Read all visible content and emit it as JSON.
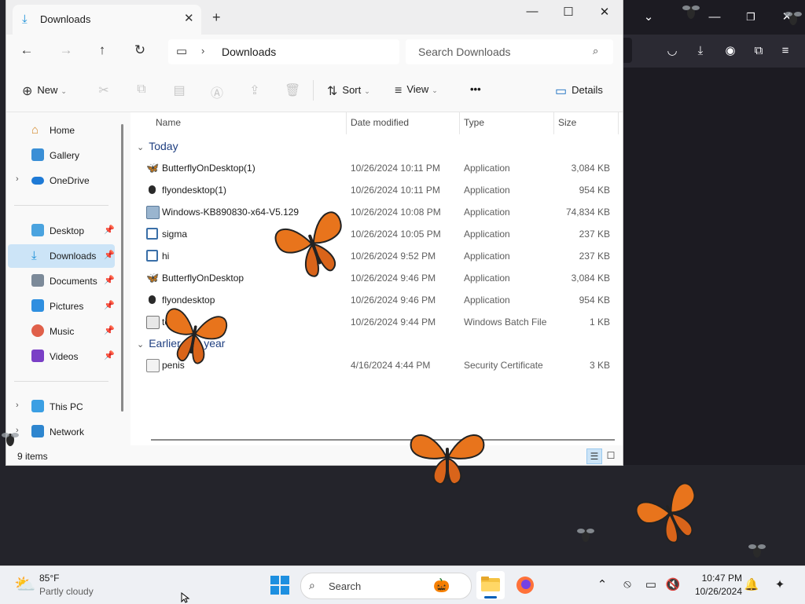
{
  "window": {
    "tab_title": "Downloads",
    "new_tab_symbol": "+",
    "minimize": "—",
    "maximize": "☐",
    "close": "✕"
  },
  "navbar": {
    "address_segment": "Downloads",
    "search_placeholder": "Search Downloads"
  },
  "toolbar": {
    "new_label": "New",
    "sort_label": "Sort",
    "view_label": "View",
    "more_label": "•••",
    "details_label": "Details"
  },
  "sidebar": {
    "items": [
      {
        "label": "Home",
        "icon": "home-icon"
      },
      {
        "label": "Gallery",
        "icon": "gallery-icon"
      },
      {
        "label": "OneDrive",
        "icon": "cloud-icon"
      },
      {
        "label": "Desktop",
        "icon": "desktop-icon"
      },
      {
        "label": "Downloads",
        "icon": "download-icon"
      },
      {
        "label": "Documents",
        "icon": "documents-icon"
      },
      {
        "label": "Pictures",
        "icon": "pictures-icon"
      },
      {
        "label": "Music",
        "icon": "music-icon"
      },
      {
        "label": "Videos",
        "icon": "videos-icon"
      },
      {
        "label": "This PC",
        "icon": "computer-icon"
      },
      {
        "label": "Network",
        "icon": "network-icon"
      }
    ]
  },
  "columns": {
    "name": "Name",
    "date": "Date modified",
    "type": "Type",
    "size": "Size"
  },
  "groups": {
    "today": "Today",
    "earlier": "Earlier this year"
  },
  "files_today": [
    {
      "name": "ButterflyOnDesktop(1)",
      "date": "10/26/2024 10:11 PM",
      "type": "Application",
      "size": "3,084 KB",
      "icon": "butterfly-icon"
    },
    {
      "name": "flyondesktop(1)",
      "date": "10/26/2024 10:11 PM",
      "type": "Application",
      "size": "954 KB",
      "icon": "fly-icon"
    },
    {
      "name": "Windows-KB890830-x64-V5.129",
      "date": "10/26/2024 10:08 PM",
      "type": "Application",
      "size": "74,834 KB",
      "icon": "installer-icon"
    },
    {
      "name": "sigma",
      "date": "10/26/2024 10:05 PM",
      "type": "Application",
      "size": "237 KB",
      "icon": "app-window-icon"
    },
    {
      "name": "hi",
      "date": "10/26/2024 9:52 PM",
      "type": "Application",
      "size": "237 KB",
      "icon": "app-window-icon"
    },
    {
      "name": "ButterflyOnDesktop",
      "date": "10/26/2024 9:46 PM",
      "type": "Application",
      "size": "3,084 KB",
      "icon": "butterfly-icon"
    },
    {
      "name": "flyondesktop",
      "date": "10/26/2024 9:46 PM",
      "type": "Application",
      "size": "954 KB",
      "icon": "fly-icon"
    },
    {
      "name": "test",
      "date": "10/26/2024 9:44 PM",
      "type": "Windows Batch File",
      "size": "1 KB",
      "icon": "batch-file-icon"
    }
  ],
  "files_earlier": [
    {
      "name": "penis",
      "date": "4/16/2024 4:44 PM",
      "type": "Security Certificate",
      "size": "3 KB",
      "icon": "certificate-icon"
    }
  ],
  "status": {
    "item_count": "9 items"
  },
  "taskbar": {
    "temperature": "85°F",
    "weather": "Partly cloudy",
    "search_label": "Search",
    "time": "10:47 PM",
    "date": "10/26/2024"
  },
  "colors": {
    "accent": "#005fb8",
    "selection": "#cce4f7",
    "butterfly": "#e8741c",
    "browser_dark": "#1c1b22"
  }
}
